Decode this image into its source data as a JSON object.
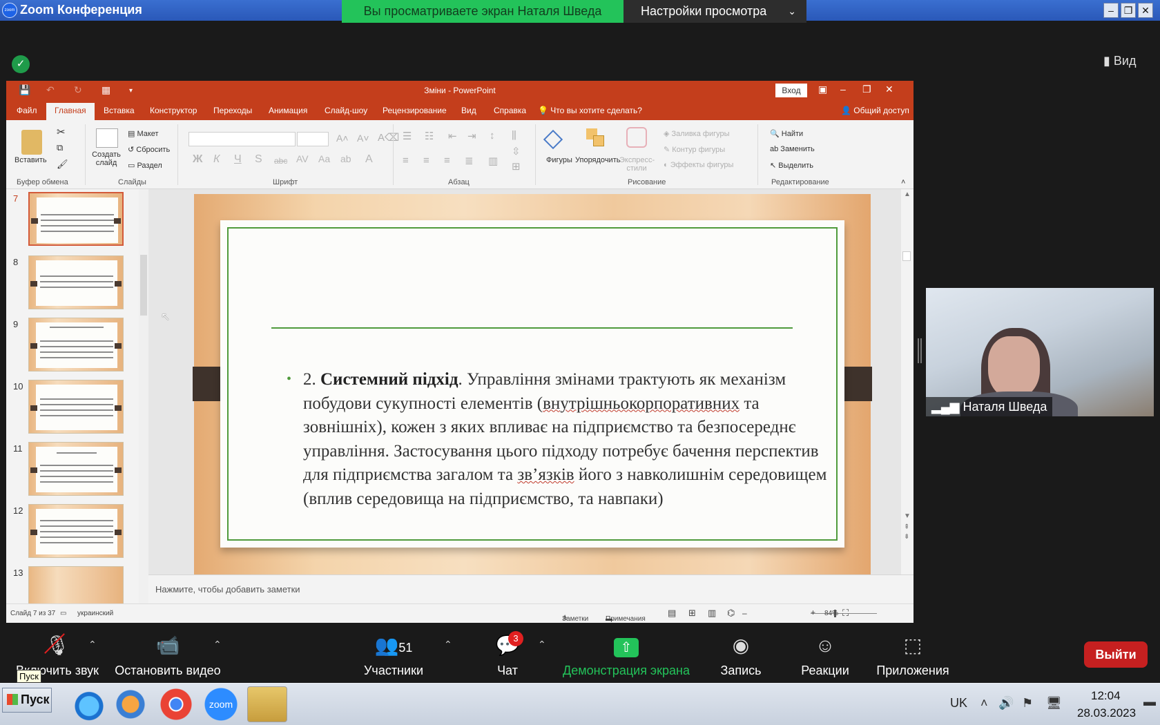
{
  "zoom": {
    "title": "Zoom Конференция",
    "logo_text": "zoom",
    "share_banner": "Вы просматриваете экран Наталя Шведа",
    "view_options": "Настройки просмотра",
    "view_button": "Вид",
    "participant_name": "Наталя Шведа",
    "controls": {
      "mute": "Включить звук",
      "video": "Остановить видео",
      "participants": "Участники",
      "participants_count": "51",
      "chat": "Чат",
      "chat_badge": "3",
      "share": "Демонстрация экрана",
      "record": "Запись",
      "reactions": "Реакции",
      "apps": "Приложения",
      "leave": "Выйти"
    },
    "tooltip": "Пуск"
  },
  "powerpoint": {
    "doc_title": "Зміни  -  PowerPoint",
    "login": "Вход",
    "tabs": [
      "Файл",
      "Главная",
      "Вставка",
      "Конструктор",
      "Переходы",
      "Анимация",
      "Слайд-шоу",
      "Рецензирование",
      "Вид",
      "Справка"
    ],
    "tell_me": "Что вы хотите сделать?",
    "share": "Общий доступ",
    "ribbon": {
      "paste": "Вставить",
      "new_slide": "Создать слайд",
      "layout": "Макет",
      "reset": "Сбросить",
      "section": "Раздел",
      "shapes": "Фигуры",
      "arrange": "Упорядочить",
      "quick_styles": "Экспресс-стили",
      "shape_fill": "Заливка фигуры",
      "shape_outline": "Контур фигуры",
      "shape_effects": "Эффекты фигуры",
      "find": "Найти",
      "replace": "Заменить",
      "select": "Выделить",
      "groups": {
        "clipboard": "Буфер обмена",
        "slides": "Слайды",
        "font": "Шрифт",
        "paragraph": "Абзац",
        "drawing": "Рисование",
        "editing": "Редактирование"
      }
    },
    "thumbnails": [
      "7",
      "8",
      "9",
      "10",
      "11",
      "12",
      "13"
    ],
    "slide": {
      "bullet_number": "2. ",
      "bold_term": "Системний підхід",
      "text_1": ". Управління змінами трактують як механізм побудови сукупності елементів (",
      "underlined_1": "внутрішньокорпоративних",
      "text_2": " та зовнішніх), кожен з яких впливає на підприємство та безпосереднє управління. Застосування цього підходу потребує бачення перспектив для підприємства загалом та ",
      "underlined_2": "зв’язків",
      "text_3": " його з навколишнім середовищем (вплив середовища на підприємство, та навпаки)"
    },
    "notes_placeholder": "Нажмите, чтобы добавить заметки",
    "status": {
      "slide_counter": "Слайд 7 из 37",
      "language": "украинский",
      "notes": "Заметки",
      "comments": "Примечания",
      "zoom_level": "84%"
    }
  },
  "taskbar": {
    "start": "Пуск",
    "lang": "UK",
    "time": "12:04",
    "date": "28.03.2023"
  }
}
